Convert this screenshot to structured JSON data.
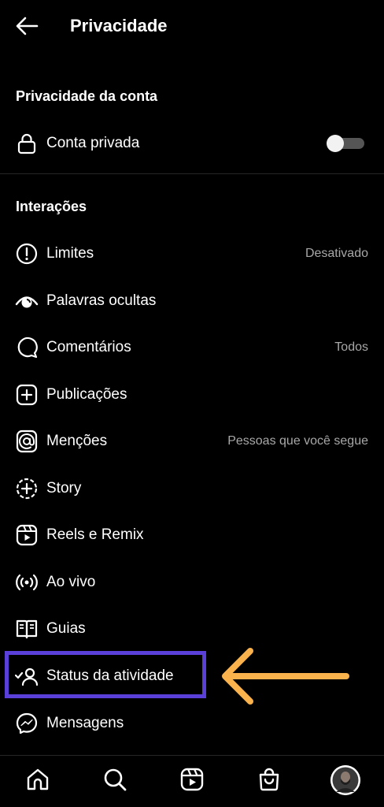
{
  "header": {
    "title": "Privacidade",
    "back_icon": "arrow-left-icon"
  },
  "account_privacy": {
    "section_title": "Privacidade da conta",
    "private_account": {
      "label": "Conta privada",
      "icon": "lock-icon",
      "enabled": false
    }
  },
  "interactions": {
    "section_title": "Interações",
    "items": [
      {
        "label": "Limites",
        "value": "Desativado",
        "icon": "alert-circle-icon"
      },
      {
        "label": "Palavras ocultas",
        "value": "",
        "icon": "eye-hidden-icon"
      },
      {
        "label": "Comentários",
        "value": "Todos",
        "icon": "comment-icon"
      },
      {
        "label": "Publicações",
        "value": "",
        "icon": "plus-square-icon"
      },
      {
        "label": "Menções",
        "value": "Pessoas que você segue",
        "icon": "at-sign-icon"
      },
      {
        "label": "Story",
        "value": "",
        "icon": "story-add-icon"
      },
      {
        "label": "Reels e Remix",
        "value": "",
        "icon": "reels-icon"
      },
      {
        "label": "Ao vivo",
        "value": "",
        "icon": "live-icon"
      },
      {
        "label": "Guias",
        "value": "",
        "icon": "guides-icon"
      },
      {
        "label": "Status da atividade",
        "value": "",
        "icon": "user-check-icon"
      },
      {
        "label": "Mensagens",
        "value": "",
        "icon": "messenger-icon"
      }
    ]
  },
  "annotation": {
    "highlight_color": "#5b3fd9",
    "arrow_color": "#f9b24c"
  },
  "bottom_nav": {
    "items": [
      "home-icon",
      "search-icon",
      "reels-icon",
      "shop-icon",
      "profile-avatar"
    ]
  },
  "colors": {
    "background": "#000000",
    "text": "#ffffff",
    "secondary_text": "#a8a8a8",
    "divider": "#262626"
  }
}
